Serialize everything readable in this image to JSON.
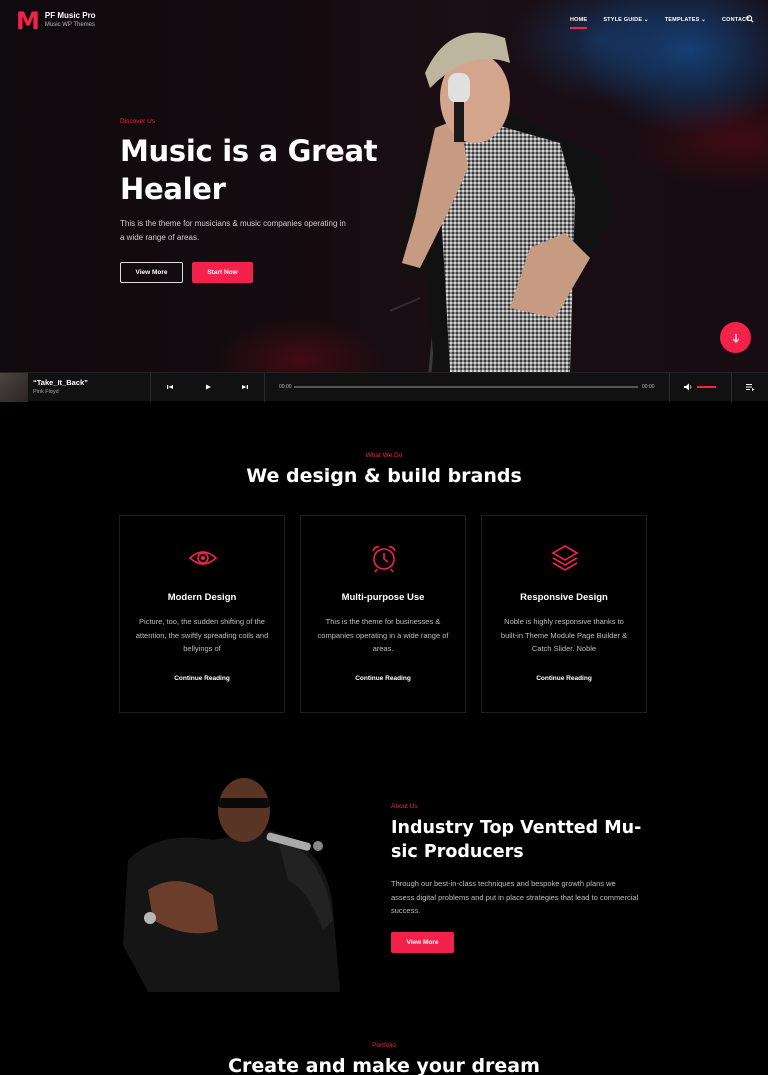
{
  "brand": {
    "mark": "M",
    "name": "PF Music Pro",
    "tagline": "Music WP Themes"
  },
  "nav": {
    "items": [
      "HOME",
      "STYLE GUIDE",
      "TEMPLATES",
      "CONTACT"
    ],
    "active": "HOME"
  },
  "colors": {
    "accent": "#f2224a",
    "background": "#000000"
  },
  "hero": {
    "eyebrow": "Discover Us",
    "title": "Music is a Great Healer",
    "text": "This is the theme for musicians & music companies operating in a wide range of areas.",
    "btn_more": "View More",
    "btn_start": "Start Now"
  },
  "player": {
    "title": "“Take_It_Back”",
    "artist": "Pink Floyd",
    "time_current": "00:00",
    "time_total": "00:00",
    "progress": 0
  },
  "services": {
    "eyebrow": "What We Do",
    "title": "We design & build brands",
    "cards": [
      {
        "icon": "eye-icon",
        "title": "Modern Design",
        "text": "Picture, too, the sudden shifting of the attention, the swiftly spreading coils and bellyings of",
        "link": "Continue Reading"
      },
      {
        "icon": "alarm-clock-icon",
        "title": "Multi-purpose Use",
        "text": "This is the theme for businesses & companies operating in a wide range of areas.",
        "link": "Continue Reading"
      },
      {
        "icon": "layers-icon",
        "title": "Responsive Design",
        "text": "Noble is highly responsive thanks to built-in Theme Module Page Builder & Catch Slider. Noble",
        "link": "Continue Reading"
      }
    ]
  },
  "about": {
    "eyebrow": "About Us",
    "title": "Industry Top Ventted Mu-sic Producers",
    "text": "Through our best-in-class techniques and bespoke growth plans we assess digital problems and put in place strategies that lead to commercial success.",
    "btn": "View More"
  },
  "portfolio": {
    "eyebrow": "Portfolio",
    "title": "Create and make your dream"
  }
}
